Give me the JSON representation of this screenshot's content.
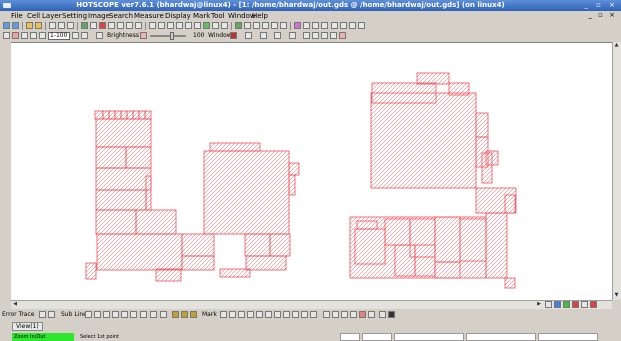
{
  "window": {
    "title": "HOTSCOPE ver7.6.1 (bhardwaj@linux4) - [1: /home/bhardwaj/out.gds @ /home/bhardwaj/out.gds] (on linux4)",
    "controls": "_ ▫ ×"
  },
  "menu": {
    "items": [
      "File",
      "Cell",
      "Layer",
      "Setting",
      "Image",
      "Search",
      "Measure",
      "Display",
      "Mark",
      "Tool",
      "Window",
      "Help"
    ],
    "mdi_controls": "_ ▫ ×"
  },
  "toolbar2": {
    "scale_value": "1-100",
    "brightness_label": "Brightness",
    "brightness_value": "100",
    "window_label": "Window"
  },
  "bottom_toolbar": {
    "error_trace_label": "Error Trace",
    "sub_line_label": "Sub Line",
    "mark_label": "Mark"
  },
  "tabs": [
    {
      "label": "View(1)"
    }
  ],
  "status": {
    "mode": "Zoom In/Out",
    "prompt": "Select 1st point"
  },
  "colors": {
    "shape_stroke": "#e8505a",
    "mode_bg": "#2ee62e",
    "title_bg": "#2f62b8"
  }
}
